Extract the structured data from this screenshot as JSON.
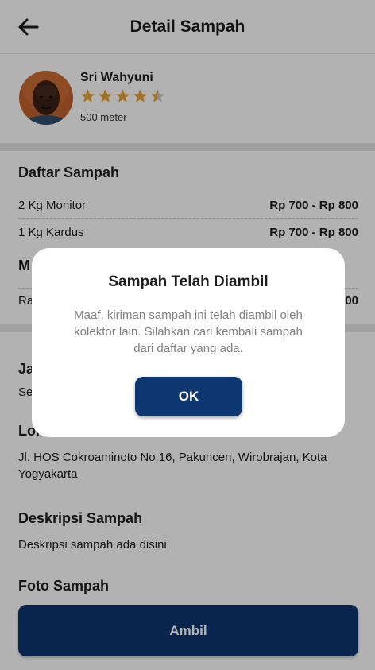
{
  "header": {
    "title": "Detail Sampah",
    "back_icon": "arrow-left-icon"
  },
  "collector": {
    "name": "Sri Wahyuni",
    "rating": 4.5,
    "rating_max": 5,
    "distance": "500 meter"
  },
  "waste_list": {
    "title": "Daftar Sampah",
    "items": [
      {
        "label": "2 Kg Monitor",
        "price": "Rp 700 - Rp 800"
      },
      {
        "label": "1 Kg Kardus",
        "price": "Rp 700 - Rp 800"
      }
    ]
  },
  "section2": {
    "title_partial": "M",
    "row_label_partial": "Ra",
    "row_value_partial": "00"
  },
  "schedule": {
    "title_partial": "Ja",
    "value_partial": "Se"
  },
  "location": {
    "title_partial": "Lok",
    "address": "Jl. HOS Cokroaminoto No.16, Pakuncen, Wirobrajan, Kota Yogyakarta"
  },
  "description": {
    "title": "Deskripsi Sampah",
    "text": "Deskripsi sampah ada disini"
  },
  "photo": {
    "title": "Foto Sampah"
  },
  "action": {
    "label": "Ambil"
  },
  "modal": {
    "title": "Sampah Telah Diambil",
    "message": "Maaf, kiriman sampah ini telah diambil oleh kolektor lain. Silahkan cari kembali sampah dari daftar yang ada.",
    "ok_label": "OK"
  },
  "colors": {
    "primary": "#0e3670",
    "star": "#e9a23b",
    "star_empty": "#c9c9c9",
    "overlay": "rgba(0,0,0,0.30)"
  }
}
